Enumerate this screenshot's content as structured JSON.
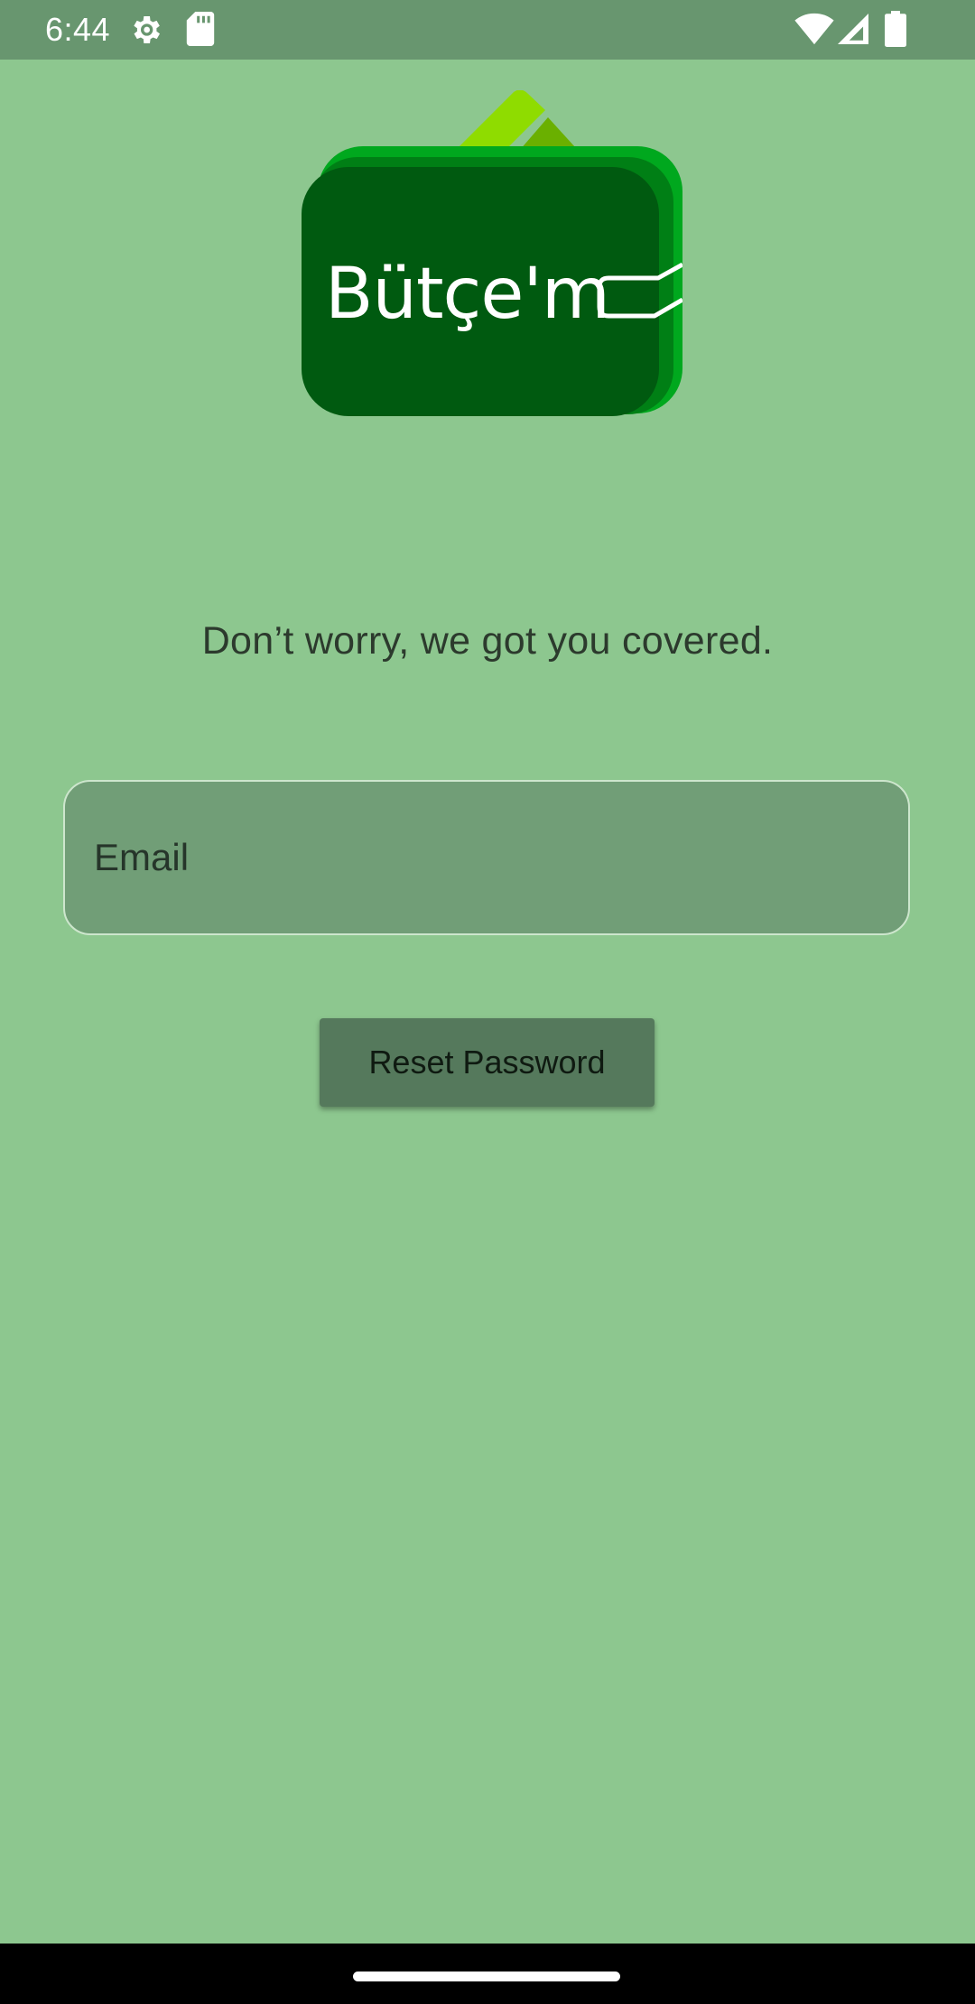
{
  "status_bar": {
    "time": "6:44",
    "icons": [
      "settings-icon",
      "sd-card-icon",
      "wifi-icon",
      "signal-icon",
      "battery-icon"
    ]
  },
  "logo": {
    "text": "Bütçe'm",
    "icon": "wallet-logo-icon",
    "colors": {
      "primary": "#005a10",
      "secondary": "#00a81e",
      "accent": "#8fdc00"
    }
  },
  "main": {
    "tagline": "Don’t worry, we got you covered.",
    "email_field": {
      "placeholder": "Email",
      "value": ""
    },
    "reset_button_label": "Reset Password"
  },
  "theme": {
    "background": "#8dc78f",
    "status_bar": "#68966f",
    "field_fill": "#719e77",
    "button_fill": "#55795c"
  }
}
